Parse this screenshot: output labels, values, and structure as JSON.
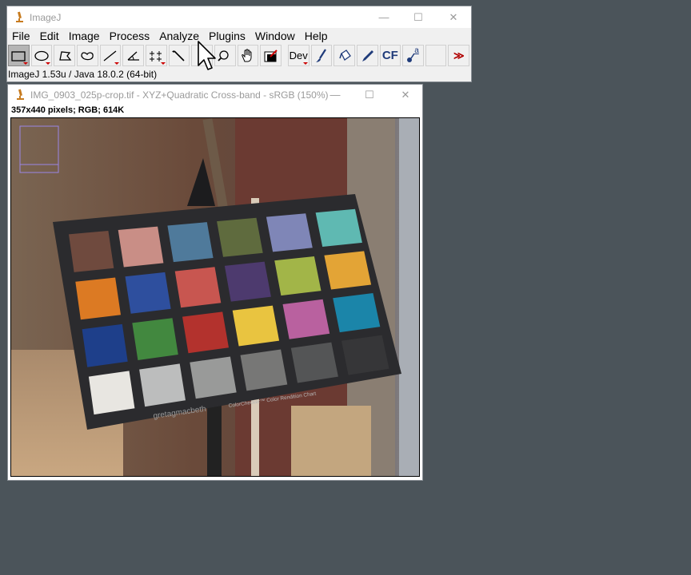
{
  "main_window": {
    "title": "ImageJ",
    "status": "ImageJ 1.53u / Java 18.0.2 (64-bit)",
    "menu": [
      "File",
      "Edit",
      "Image",
      "Process",
      "Analyze",
      "Plugins",
      "Window",
      "Help"
    ],
    "tools": [
      {
        "name": "rectangle-tool",
        "selected": true
      },
      {
        "name": "oval-tool"
      },
      {
        "name": "polygon-tool"
      },
      {
        "name": "freehand-tool"
      },
      {
        "name": "line-tool"
      },
      {
        "name": "angle-tool"
      },
      {
        "name": "point-tool"
      },
      {
        "name": "wand-tool"
      },
      {
        "name": "text-tool"
      },
      {
        "name": "zoom-tool"
      },
      {
        "name": "hand-tool"
      },
      {
        "name": "color-picker-tool"
      },
      {
        "name": "dev-tool",
        "label": "Dev"
      },
      {
        "name": "brush-tool"
      },
      {
        "name": "flood-fill-tool"
      },
      {
        "name": "pencil-tool"
      },
      {
        "name": "cf-tool",
        "label": "CF"
      },
      {
        "name": "label-tool",
        "label": "a"
      },
      {
        "name": "empty-tool"
      },
      {
        "name": "more-tools",
        "label": "≫"
      }
    ]
  },
  "image_window": {
    "title": "IMG_0903_025p-crop.tif - XYZ+Quadratic Cross-band - sRGB (150%)",
    "info": "357x440 pixels; RGB; 614K",
    "chart_brand": "gretagmacbeth",
    "chart_name": "ColorChecker™ Color Rendition Chart",
    "patches": [
      "#6f4a3e",
      "#c98e86",
      "#4f7a9b",
      "#5f6b3e",
      "#7f86b7",
      "#5fb9b2",
      "#dc7a23",
      "#2e4f9e",
      "#c85650",
      "#4d3a6e",
      "#a2b548",
      "#e3a436",
      "#1e3f8a",
      "#42883f",
      "#b3322d",
      "#e9c440",
      "#b9619f",
      "#1b85a9",
      "#e8e6e1",
      "#bcbdbd",
      "#999a99",
      "#777776",
      "#545556",
      "#363638"
    ]
  }
}
